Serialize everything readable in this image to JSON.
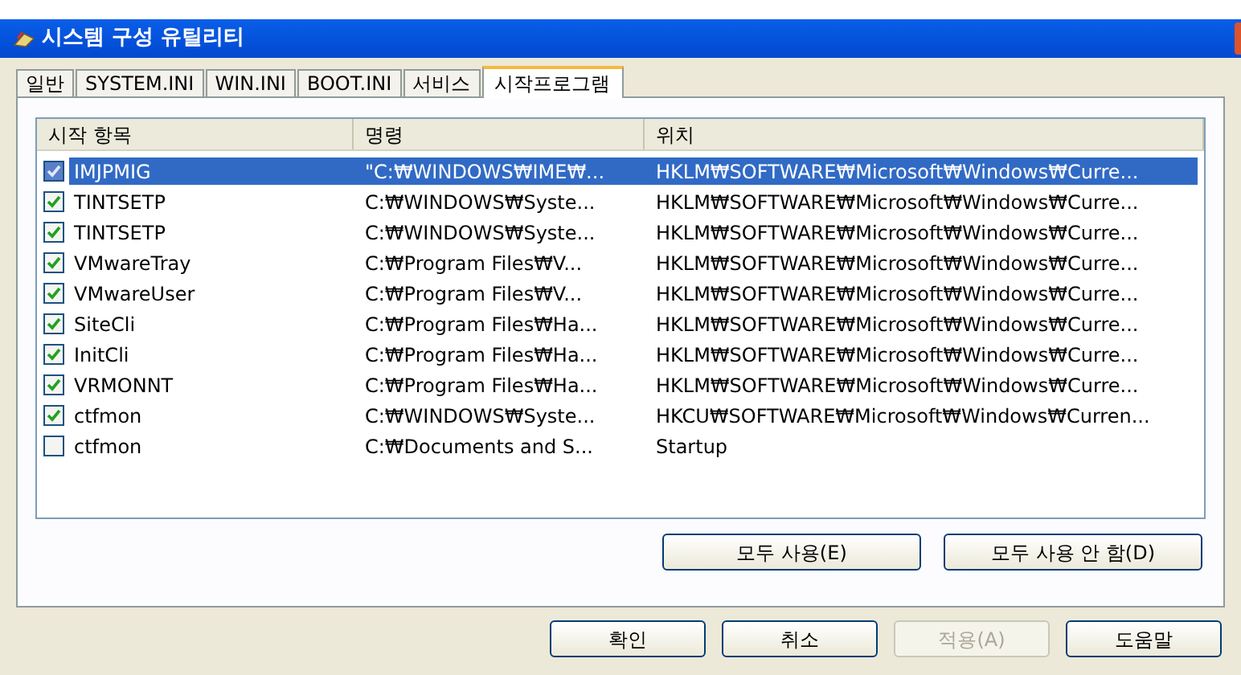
{
  "window": {
    "title": "시스템 구성 유틸리티"
  },
  "tabs": [
    {
      "label": "일반",
      "selected": false
    },
    {
      "label": "SYSTEM.INI",
      "selected": false
    },
    {
      "label": "WIN.INI",
      "selected": false
    },
    {
      "label": "BOOT.INI",
      "selected": false
    },
    {
      "label": "서비스",
      "selected": false
    },
    {
      "label": "시작프로그램",
      "selected": true
    }
  ],
  "table": {
    "columns": [
      "시작 항목",
      "명령",
      "위치"
    ],
    "rows": [
      {
        "name": "IMJPMIG",
        "command": "\"C:₩WINDOWS₩IME₩...",
        "location": "HKLM₩SOFTWARE₩Microsoft₩Windows₩Curre...",
        "checked": true,
        "selected": true
      },
      {
        "name": "TINTSETP",
        "command": "C:₩WINDOWS₩Syste...",
        "location": "HKLM₩SOFTWARE₩Microsoft₩Windows₩Curre...",
        "checked": true,
        "selected": false
      },
      {
        "name": "TINTSETP",
        "command": "C:₩WINDOWS₩Syste...",
        "location": "HKLM₩SOFTWARE₩Microsoft₩Windows₩Curre...",
        "checked": true,
        "selected": false
      },
      {
        "name": "VMwareTray",
        "command": "C:₩Program Files₩V...",
        "location": "HKLM₩SOFTWARE₩Microsoft₩Windows₩Curre...",
        "checked": true,
        "selected": false
      },
      {
        "name": "VMwareUser",
        "command": "C:₩Program Files₩V...",
        "location": "HKLM₩SOFTWARE₩Microsoft₩Windows₩Curre...",
        "checked": true,
        "selected": false
      },
      {
        "name": "SiteCli",
        "command": "C:₩Program Files₩Ha...",
        "location": "HKLM₩SOFTWARE₩Microsoft₩Windows₩Curre...",
        "checked": true,
        "selected": false
      },
      {
        "name": "InitCli",
        "command": "C:₩Program Files₩Ha...",
        "location": "HKLM₩SOFTWARE₩Microsoft₩Windows₩Curre...",
        "checked": true,
        "selected": false
      },
      {
        "name": "VRMONNT",
        "command": "C:₩Program Files₩Ha...",
        "location": "HKLM₩SOFTWARE₩Microsoft₩Windows₩Curre...",
        "checked": true,
        "selected": false
      },
      {
        "name": "ctfmon",
        "command": "C:₩WINDOWS₩Syste...",
        "location": "HKCU₩SOFTWARE₩Microsoft₩Windows₩Curren...",
        "checked": true,
        "selected": false
      },
      {
        "name": "ctfmon",
        "command": "C:₩Documents and S...",
        "location": "Startup",
        "checked": false,
        "selected": false
      }
    ]
  },
  "list_buttons": [
    "모두 사용(E)",
    "모두 사용 안 함(D)"
  ],
  "dialog_buttons": [
    {
      "label": "확인",
      "disabled": false
    },
    {
      "label": "취소",
      "disabled": false
    },
    {
      "label": "적용(A)",
      "disabled": true
    },
    {
      "label": "도움말",
      "disabled": false
    }
  ]
}
